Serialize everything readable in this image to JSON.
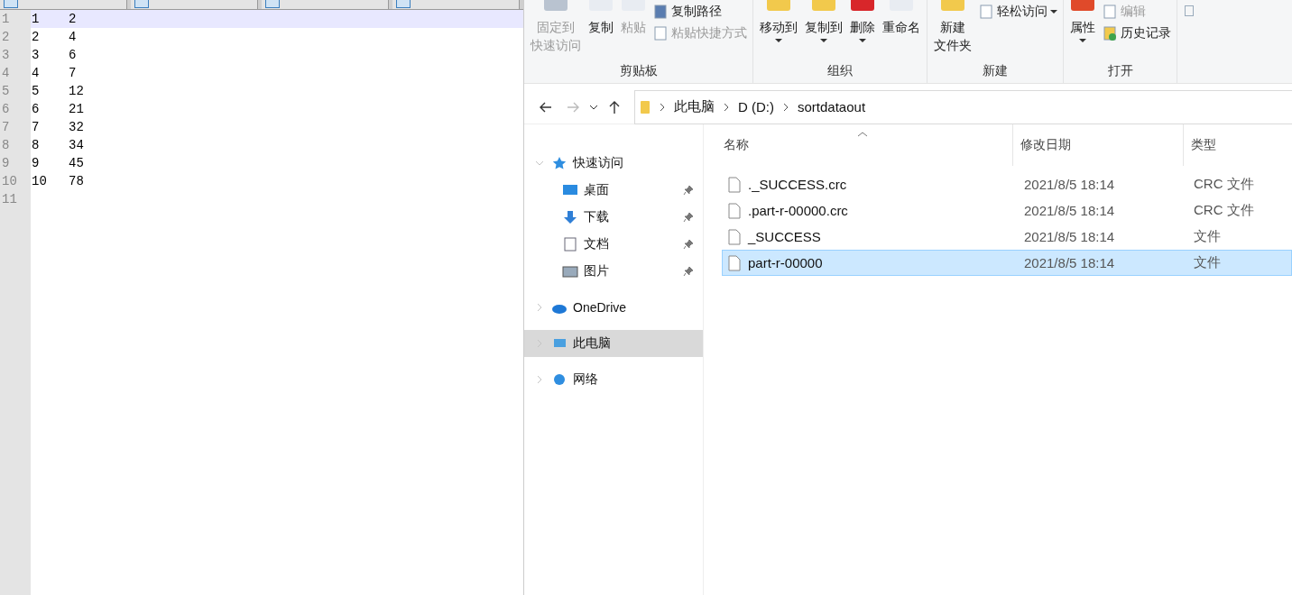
{
  "editor": {
    "lines": [
      {
        "number": "1",
        "columns": [
          "1",
          "2"
        ],
        "current": true
      },
      {
        "number": "2",
        "columns": [
          "2",
          "4"
        ],
        "current": false
      },
      {
        "number": "3",
        "columns": [
          "3",
          "6"
        ],
        "current": false
      },
      {
        "number": "4",
        "columns": [
          "4",
          "7"
        ],
        "current": false
      },
      {
        "number": "5",
        "columns": [
          "5",
          "12"
        ],
        "current": false
      },
      {
        "number": "6",
        "columns": [
          "6",
          "21"
        ],
        "current": false
      },
      {
        "number": "7",
        "columns": [
          "7",
          "32"
        ],
        "current": false
      },
      {
        "number": "8",
        "columns": [
          "8",
          "34"
        ],
        "current": false
      },
      {
        "number": "9",
        "columns": [
          "9",
          "45"
        ],
        "current": false
      },
      {
        "number": "10",
        "columns": [
          "10",
          "78"
        ],
        "current": false
      },
      {
        "number": "11",
        "current": false
      }
    ]
  },
  "explorer": {
    "ribbon": {
      "groups": [
        {
          "label": "剪贴板",
          "items": [
            {
              "kind": "large",
              "lines": [
                "固定到",
                "快速访问"
              ],
              "disabled": true,
              "dropdown": false
            },
            {
              "kind": "large",
              "lines": [
                "复制"
              ],
              "disabled": false,
              "dropdown": false
            },
            {
              "kind": "large",
              "lines": [
                "粘贴"
              ],
              "disabled": true,
              "dropdown": false
            },
            {
              "kind": "small",
              "items": [
                {
                  "label": "复制路径",
                  "disabled": false,
                  "dropdown": false
                },
                {
                  "label": "粘贴快捷方式",
                  "disabled": true,
                  "dropdown": false
                }
              ]
            }
          ]
        },
        {
          "label": "组织",
          "items": [
            {
              "kind": "large",
              "lines": [
                "移动到"
              ],
              "disabled": false,
              "dropdown": true
            },
            {
              "kind": "large",
              "lines": [
                "复制到"
              ],
              "disabled": false,
              "dropdown": true
            },
            {
              "kind": "large",
              "lines": [
                "删除"
              ],
              "disabled": false,
              "dropdown": true
            },
            {
              "kind": "large",
              "lines": [
                "重命名"
              ],
              "disabled": false,
              "dropdown": false
            }
          ]
        },
        {
          "label": "新建",
          "items": [
            {
              "kind": "large",
              "lines": [
                "新建",
                "文件夹"
              ],
              "disabled": false,
              "dropdown": false
            },
            {
              "kind": "small",
              "items": [
                {
                  "label": "轻松访问",
                  "disabled": false,
                  "dropdown": true
                }
              ]
            }
          ]
        },
        {
          "label": "打开",
          "items": [
            {
              "kind": "large",
              "lines": [
                "属性"
              ],
              "disabled": false,
              "dropdown": true
            },
            {
              "kind": "small",
              "items": [
                {
                  "label": "编辑",
                  "disabled": true,
                  "dropdown": false
                },
                {
                  "label": "历史记录",
                  "disabled": false,
                  "dropdown": false
                }
              ]
            }
          ]
        }
      ]
    },
    "breadcrumb": [
      "此电脑",
      "D (D:)",
      "sortdataout"
    ],
    "navigation": [
      {
        "label": "快速访问",
        "expanded": true,
        "selected": false,
        "children": [
          {
            "label": "桌面",
            "pinned": true,
            "selected": false
          },
          {
            "label": "下载",
            "pinned": true,
            "selected": false
          },
          {
            "label": "文档",
            "pinned": true,
            "selected": false
          },
          {
            "label": "图片",
            "pinned": true,
            "selected": false
          }
        ]
      },
      {
        "label": "OneDrive",
        "expanded": false,
        "selected": false
      },
      {
        "label": "此电脑",
        "expanded": false,
        "selected": true
      },
      {
        "label": "网络",
        "expanded": false,
        "selected": false
      }
    ],
    "columns": [
      "名称",
      "修改日期",
      "类型"
    ],
    "files": [
      {
        "name": "._SUCCESS.crc",
        "modified": "2021/8/5 18:14",
        "type": "CRC 文件",
        "selected": false
      },
      {
        "name": ".part-r-00000.crc",
        "modified": "2021/8/5 18:14",
        "type": "CRC 文件",
        "selected": false
      },
      {
        "name": "_SUCCESS",
        "modified": "2021/8/5 18:14",
        "type": "文件",
        "selected": false
      },
      {
        "name": "part-r-00000",
        "modified": "2021/8/5 18:14",
        "type": "文件",
        "selected": true
      }
    ]
  }
}
